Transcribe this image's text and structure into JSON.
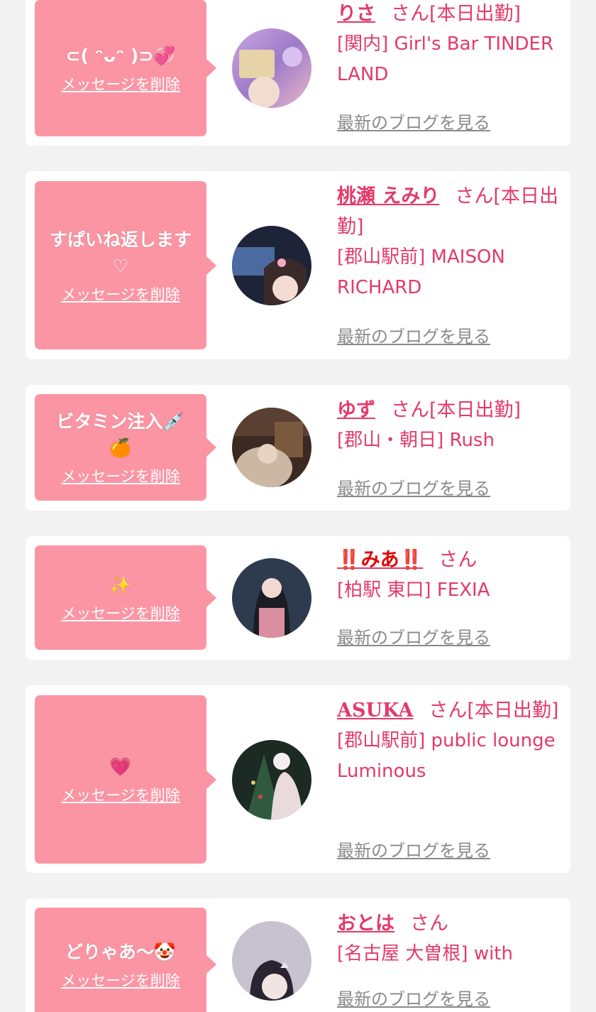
{
  "delete_label": "メッセージを削除",
  "blog_label": "最新のブログを見る",
  "san_label": "さん",
  "colors": {
    "background": "#f2f2f2",
    "bubble": "#fb95a4",
    "accent": "#e33a6a",
    "link_gray": "#8a8a8a"
  },
  "cards": [
    {
      "message": "⊂( ᵔᴗᵔ )⊃💞",
      "name": "りさ",
      "status": "[本日出勤]",
      "shop": "[関内] Girl's Bar TINDER LAND",
      "avatar": "avatar-photo-risa"
    },
    {
      "message": "すぱいね返します\n♡",
      "name": "桃瀬 えみり",
      "status": "[本日出勤]",
      "shop": "[郡山駅前] MAISON RICHARD",
      "avatar": "avatar-photo-emiri"
    },
    {
      "message": "ビタミン注入💉\n🍊",
      "name": "ゆず",
      "status": "[本日出勤]",
      "shop": "[郡山・朝日] Rush",
      "avatar": "avatar-photo-yuzu"
    },
    {
      "message": "✨",
      "name": "‼️みあ‼️",
      "status": "",
      "shop": "[柏駅 東口] FEXIA",
      "avatar": "avatar-photo-mia"
    },
    {
      "message": "💗",
      "name": "ASUKA",
      "status": "[本日出勤]",
      "shop": "[郡山駅前] public lounge Luminous",
      "avatar": "avatar-photo-asuka"
    },
    {
      "message": "どりゃあ〜🤡",
      "name": "おとは",
      "status": "",
      "shop": "[名古屋 大曽根] with",
      "avatar": "avatar-photo-otoha"
    }
  ]
}
